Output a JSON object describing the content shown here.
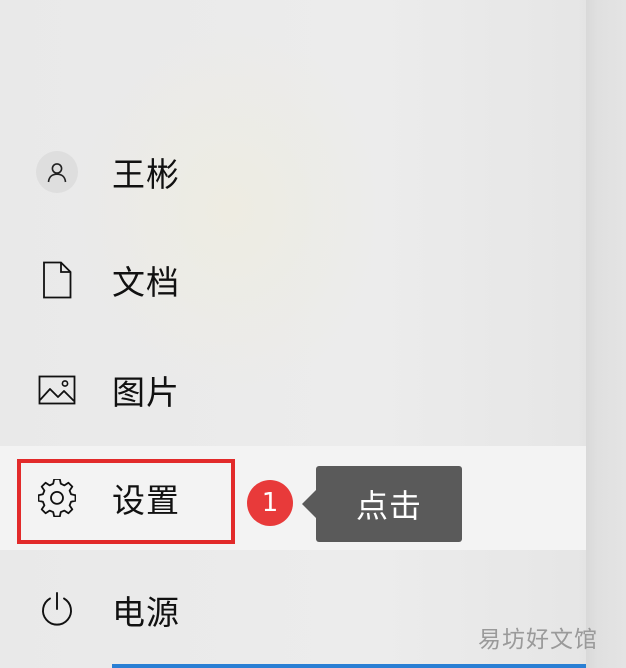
{
  "menu": {
    "items": [
      {
        "label": "王彬",
        "icon": "user-icon"
      },
      {
        "label": "文档",
        "icon": "document-icon"
      },
      {
        "label": "图片",
        "icon": "image-icon"
      },
      {
        "label": "设置",
        "icon": "gear-icon"
      },
      {
        "label": "电源",
        "icon": "power-icon"
      }
    ]
  },
  "annotation": {
    "step_number": "1",
    "tooltip_text": "点击",
    "highlight_color": "#e22a2a",
    "badge_color": "#e83a3a",
    "tooltip_color": "#5a5a5a"
  },
  "watermark": {
    "text": "易坊好文馆"
  }
}
